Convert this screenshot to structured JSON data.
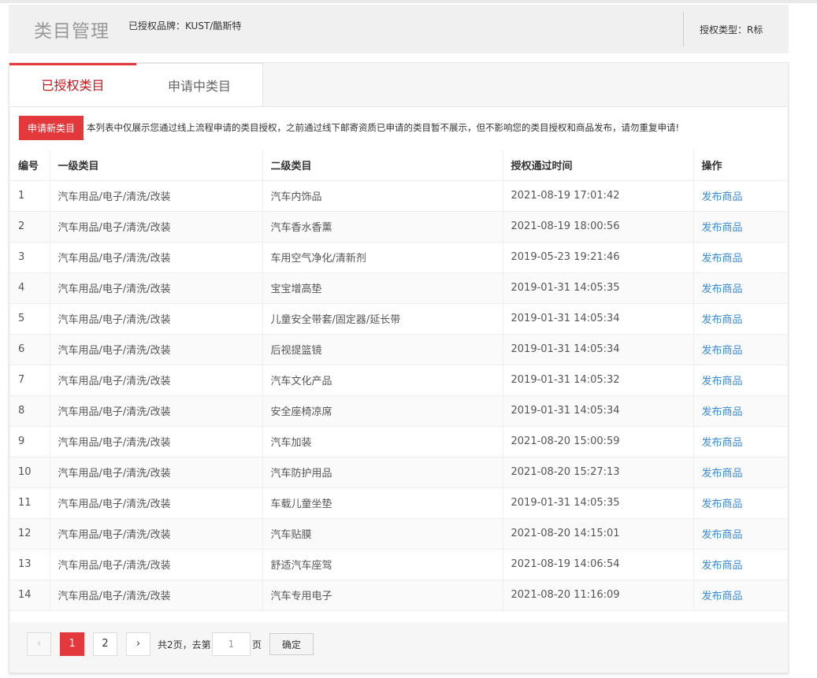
{
  "header": {
    "title": "类目管理",
    "brand_label": "已授权品牌：KUST/酷斯特",
    "auth_type": "授权类型：R标"
  },
  "tabs": [
    {
      "label": "已授权类目",
      "active": true
    },
    {
      "label": "申请中类目",
      "active": false
    }
  ],
  "toolbar": {
    "apply_label": "申请新类目",
    "notice": "本列表中仅展示您通过线上流程申请的类目授权，之前通过线下邮寄资质已申请的类目暂不展示，但不影响您的类目授权和商品发布，请勿重复申请!"
  },
  "table": {
    "columns": [
      "编号",
      "一级类目",
      "二级类目",
      "授权通过时间",
      "操作"
    ],
    "rows": [
      [
        "1",
        "汽车用品/电子/清洗/改装",
        "汽车内饰品",
        "2021-08-19 17:01:42",
        "发布商品"
      ],
      [
        "2",
        "汽车用品/电子/清洗/改装",
        "汽车香水香薰",
        "2021-08-19 18:00:56",
        "发布商品"
      ],
      [
        "3",
        "汽车用品/电子/清洗/改装",
        "车用空气净化/清新剂",
        "2019-05-23 19:21:46",
        "发布商品"
      ],
      [
        "4",
        "汽车用品/电子/清洗/改装",
        "宝宝增高垫",
        "2019-01-31 14:05:35",
        "发布商品"
      ],
      [
        "5",
        "汽车用品/电子/清洗/改装",
        "儿童安全带套/固定器/延长带",
        "2019-01-31 14:05:34",
        "发布商品"
      ],
      [
        "6",
        "汽车用品/电子/清洗/改装",
        "后视提篮镜",
        "2019-01-31 14:05:34",
        "发布商品"
      ],
      [
        "7",
        "汽车用品/电子/清洗/改装",
        "汽车文化产品",
        "2019-01-31 14:05:32",
        "发布商品"
      ],
      [
        "8",
        "汽车用品/电子/清洗/改装",
        "安全座椅凉席",
        "2019-01-31 14:05:34",
        "发布商品"
      ],
      [
        "9",
        "汽车用品/电子/清洗/改装",
        "汽车加装",
        "2021-08-20 15:00:59",
        "发布商品"
      ],
      [
        "10",
        "汽车用品/电子/清洗/改装",
        "汽车防护用品",
        "2021-08-20 15:27:13",
        "发布商品"
      ],
      [
        "11",
        "汽车用品/电子/清洗/改装",
        "车载儿童坐垫",
        "2019-01-31 14:05:35",
        "发布商品"
      ],
      [
        "12",
        "汽车用品/电子/清洗/改装",
        "汽车贴膜",
        "2021-08-20 14:15:01",
        "发布商品"
      ],
      [
        "13",
        "汽车用品/电子/清洗/改装",
        "舒适汽车座驾",
        "2021-08-19 14:06:54",
        "发布商品"
      ],
      [
        "14",
        "汽车用品/电子/清洗/改装",
        "汽车专用电子",
        "2021-08-20 11:16:09",
        "发布商品"
      ]
    ]
  },
  "pagination": {
    "prev": "‹",
    "next": "›",
    "pages": [
      "1",
      "2"
    ],
    "current": "1",
    "total_text": "共2页，去第",
    "input_value": "1",
    "suffix": "页",
    "confirm": "确定"
  },
  "colors": {
    "accent": "#e4393c",
    "link": "#3a8bd6"
  },
  "icons": {
    "prev": "chevron-left-icon",
    "next": "chevron-right-icon"
  }
}
